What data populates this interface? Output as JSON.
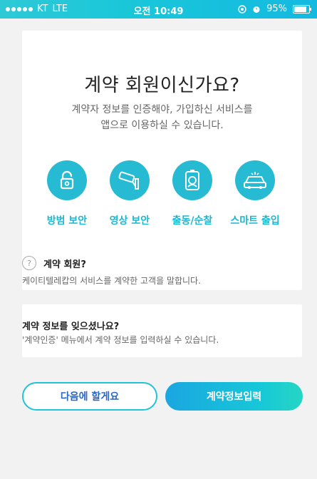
{
  "status_bar": {
    "carrier": "KT",
    "network": "LTE",
    "time": "오전 10:49",
    "battery_percent": "95%",
    "battery_level": 0.95,
    "signal_bars": 5
  },
  "main": {
    "title": "계약 회원이신가요?",
    "subtitle_line1": "계약자 정보를 인증해야, 가입하신 서비스를",
    "subtitle_line2": "앱으로 이용하실 수 있습니다.",
    "services": [
      {
        "label": "방범 보안",
        "icon": "lock-icon"
      },
      {
        "label": "영상 보안",
        "icon": "cctv-camera-icon"
      },
      {
        "label": "출동/순찰",
        "icon": "security-guard-icon"
      },
      {
        "label": "스마트 출입",
        "icon": "car-icon"
      }
    ],
    "info": {
      "icon": "question-icon",
      "heading": "계약 회원?",
      "description": "케이티텔레캅의 서비스를 계약한 고객을 말합니다."
    }
  },
  "forgot": {
    "heading": "계약 정보를 잊으셨나요?",
    "description": "'계약인증' 메뉴에서 계약 정보를 입력하실 수 있습니다."
  },
  "buttons": {
    "later_label": "다음에 할게요",
    "input_label": "계약정보입력"
  },
  "colors": {
    "accent": "#27bbd3",
    "label_blue": "#1fb6d2",
    "later_text": "#2a67c6",
    "background": "#f2f2f2"
  }
}
